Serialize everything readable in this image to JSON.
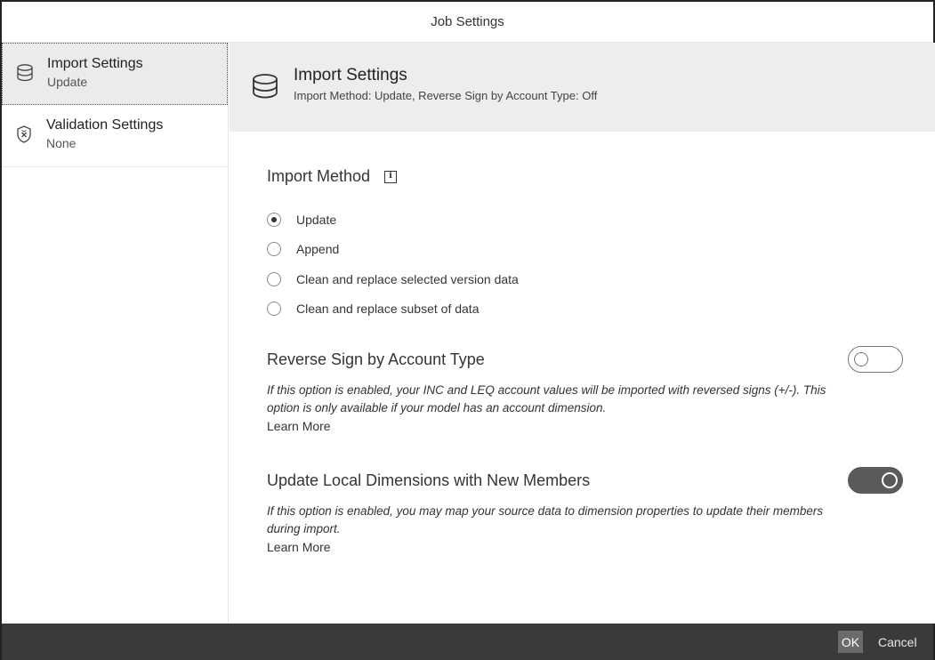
{
  "dialog": {
    "title": "Job Settings"
  },
  "sidebar": {
    "items": [
      {
        "title": "Import Settings",
        "subtitle": "Update",
        "icon": "database-icon"
      },
      {
        "title": "Validation Settings",
        "subtitle": "None",
        "icon": "shield-x-icon"
      }
    ]
  },
  "content": {
    "header": {
      "title": "Import Settings",
      "subtitle": "Import Method: Update, Reverse Sign by Account Type: Off"
    },
    "import_method": {
      "title": "Import Method",
      "info_glyph": "i",
      "options": [
        {
          "label": "Update",
          "checked": true
        },
        {
          "label": "Append",
          "checked": false
        },
        {
          "label": "Clean and replace selected version data",
          "checked": false
        },
        {
          "label": "Clean and replace subset of data",
          "checked": false
        }
      ]
    },
    "reverse_sign": {
      "title": "Reverse Sign by Account Type",
      "description": "If this option is enabled, your INC and LEQ account values will be imported with reversed signs (+/-). This option is only available if your model has an account dimension.",
      "learn_more": "Learn More",
      "enabled": false
    },
    "update_local": {
      "title": "Update Local Dimensions with New Members",
      "description": "If this option is enabled, you may map your source data to dimension properties to update their members during import.",
      "learn_more": "Learn More",
      "enabled": true
    }
  },
  "footer": {
    "ok_label": "OK",
    "cancel_label": "Cancel"
  },
  "colors": {
    "footer_bg": "#3a3a3a",
    "selected_bg": "#ebebeb",
    "toggle_on": "#5a5a5a"
  }
}
